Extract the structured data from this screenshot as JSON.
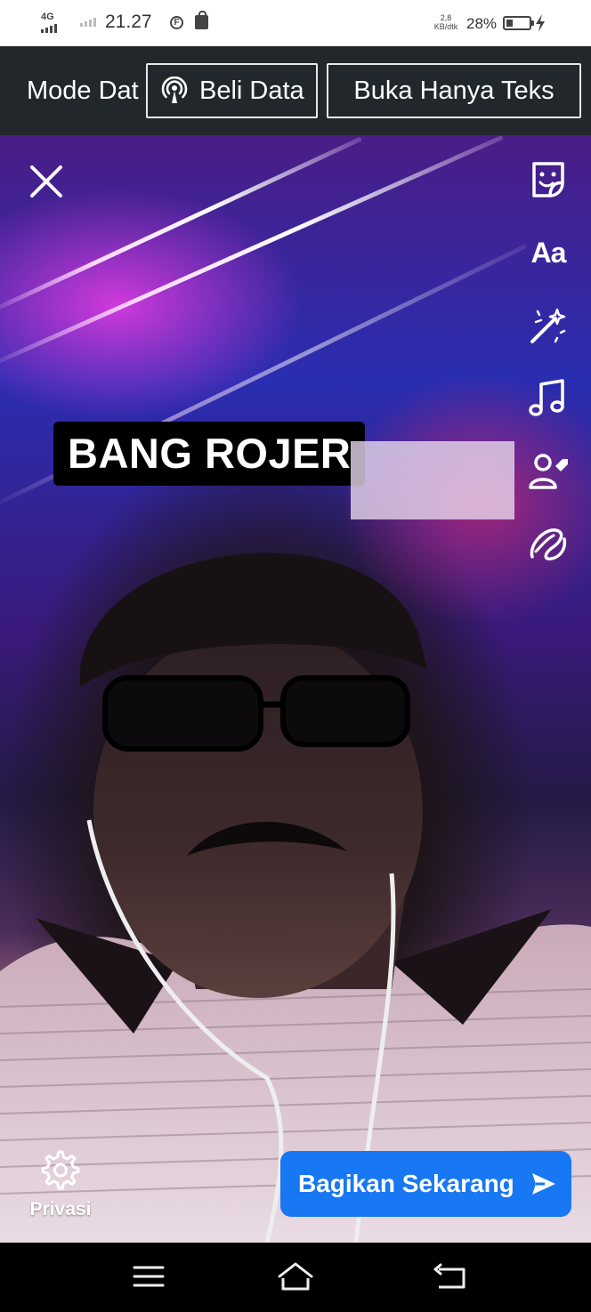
{
  "status_bar": {
    "network": "4G",
    "time": "21.27",
    "facebook_icon": "F",
    "speed_value": "2,8",
    "speed_unit": "KB/dtk",
    "battery_percent": "28%",
    "battery_level": 0.28
  },
  "data_bar": {
    "mode_label": "Mode Dat",
    "buy_data_label": "Beli Data",
    "text_only_label": "Buka Hanya Teks"
  },
  "story": {
    "name_tag": "BANG ROJER",
    "tools": {
      "text_label": "Aa",
      "icons": [
        "sticker-icon",
        "text-tool-icon",
        "effects-wand-icon",
        "music-note-icon",
        "tag-people-icon",
        "doodle-icon"
      ]
    },
    "privacy_label": "Privasi",
    "share_label": "Bagikan Sekarang"
  },
  "nav_bar": {
    "icons": [
      "menu-icon",
      "home-icon",
      "back-icon"
    ]
  },
  "colors": {
    "share_button": "#1877f2",
    "data_bar": "#22272b",
    "status_bar": "#ffffff"
  }
}
